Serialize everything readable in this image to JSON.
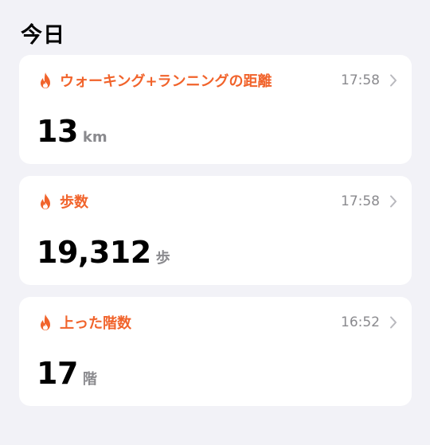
{
  "section": {
    "title": "今日"
  },
  "cards": [
    {
      "label": "ウォーキング+ランニングの距離",
      "time": "17:58",
      "value": "13",
      "unit": "km"
    },
    {
      "label": "歩数",
      "time": "17:58",
      "value": "19,312",
      "unit": "歩"
    },
    {
      "label": "上った階数",
      "time": "16:52",
      "value": "17",
      "unit": "階"
    }
  ],
  "colors": {
    "accent": "#f1632b",
    "background": "#f2f2f7",
    "card": "#ffffff",
    "secondary_text": "#8a8a8e"
  },
  "icons": {
    "metric": "flame-icon",
    "disclosure": "chevron-right-icon"
  }
}
